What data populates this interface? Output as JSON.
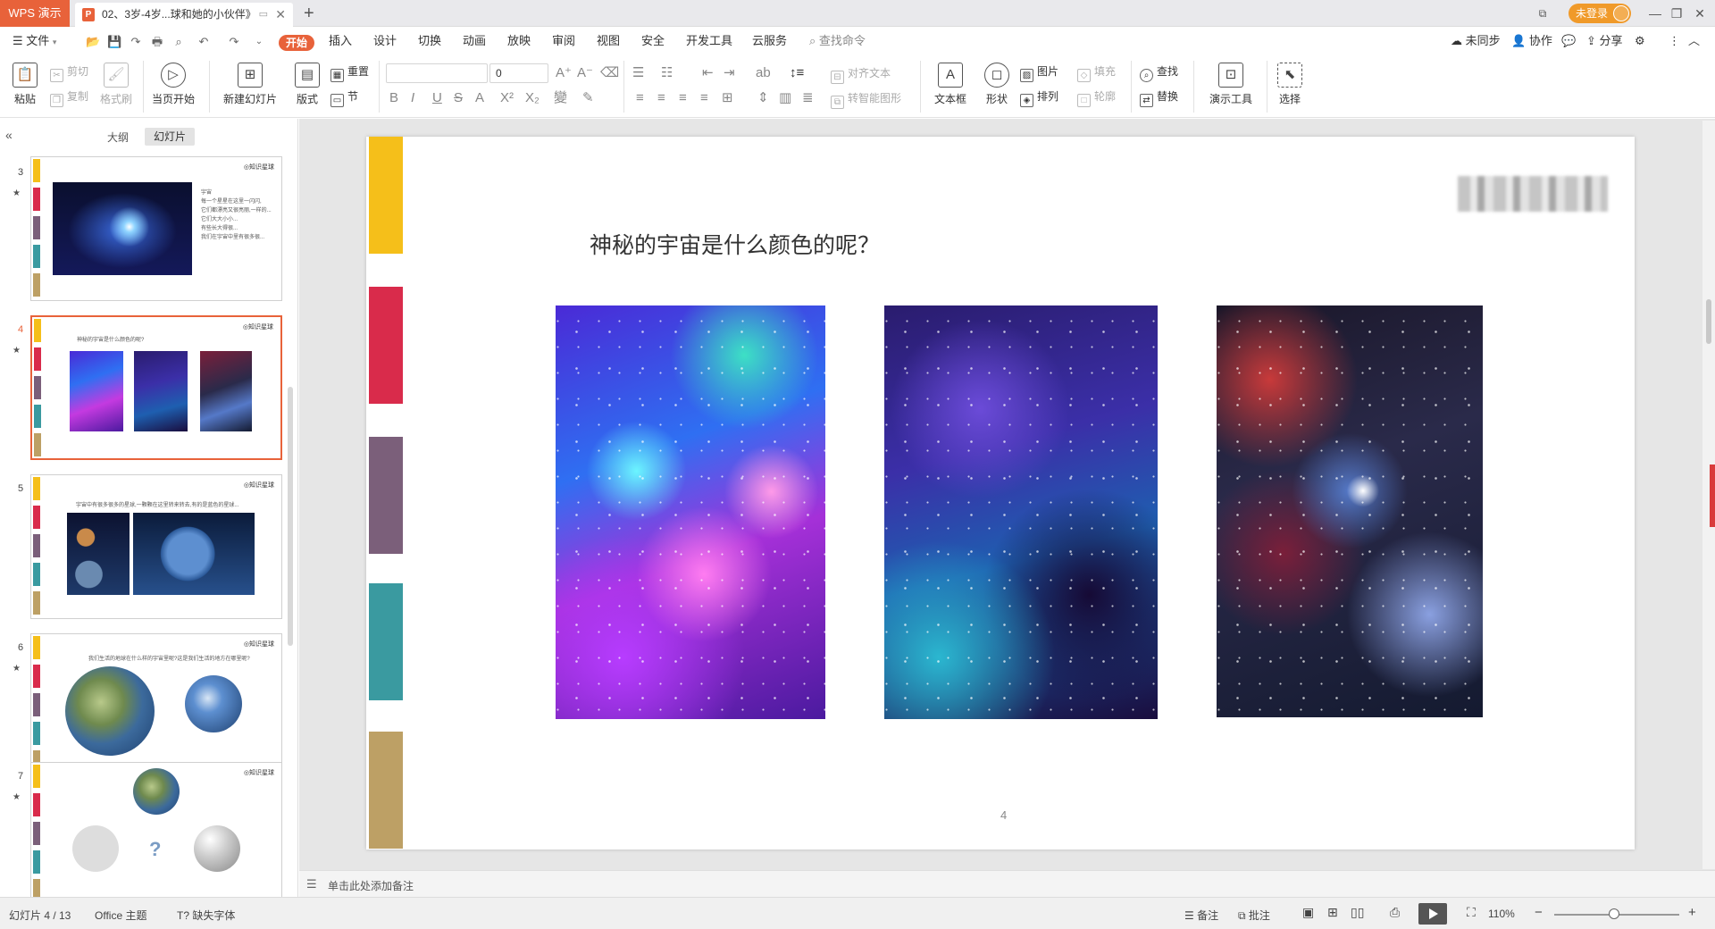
{
  "titlebar": {
    "app_tab": "WPS 演示",
    "doc_tab": "02、3岁-4岁...球和她的小伙伴》",
    "doc_icon": "P",
    "login_label": "未登录"
  },
  "menu": {
    "file": "文件",
    "start": "开始",
    "items": [
      "插入",
      "设计",
      "切换",
      "动画",
      "放映",
      "审阅",
      "视图",
      "安全",
      "开发工具",
      "云服务"
    ],
    "search_placeholder": "查找命令",
    "right": {
      "sync": "未同步",
      "collab": "协作",
      "share": "分享"
    }
  },
  "ribbon": {
    "paste": "粘贴",
    "cut": "剪切",
    "copy": "复制",
    "format_painter": "格式刷",
    "from_current": "当页开始",
    "new_slide": "新建幻灯片",
    "layout": "版式",
    "reset": "重置",
    "section": "节",
    "font_size_value": "0",
    "align_text": "对齐文本",
    "smartart": "转智能图形",
    "textbox": "文本框",
    "shape": "形状",
    "picture": "图片",
    "arrange": "排列",
    "fill": "填充",
    "outline": "轮廓",
    "find": "查找",
    "replace": "替换",
    "presenter_tools": "演示工具",
    "select": "选择"
  },
  "left_panel": {
    "tab_outline": "大纲",
    "tab_slides": "幻灯片",
    "thumbnails": [
      {
        "num": "3",
        "logo": "◎知识星球",
        "lines": [
          "宇宙",
          "每一个星星在这里一闪闪,",
          "它们都漂亮又很亮丽,一样的...",
          "它们大大小小...",
          "有些长大得很...",
          "我们在宇宙中里有很多很..."
        ]
      },
      {
        "num": "4",
        "logo": "◎知识星球",
        "lines": [
          "神秘的宇宙是什么颜色的呢?"
        ]
      },
      {
        "num": "5",
        "logo": "◎知识星球",
        "lines": [
          "宇宙中有很多很多的星球,一颗颗在这里转来转去,有的是蓝色的星球..."
        ]
      },
      {
        "num": "6",
        "logo": "◎知识星球",
        "lines": [
          "我们生活的地球在什么样的宇宙里呢?这是我们生活的地方在哪里呢?"
        ]
      },
      {
        "num": "7",
        "logo": "◎知识星球",
        "lines": [
          "?"
        ]
      }
    ]
  },
  "slide": {
    "title": "神秘的宇宙是什么颜色的呢？",
    "page_number": "4",
    "stripe_colors": [
      "#f5bf1a",
      "#d92b4b",
      "#7b5f7a",
      "#3a9aa0",
      "#bda065"
    ]
  },
  "notes": {
    "placeholder": "单击此处添加备注"
  },
  "status": {
    "slide_counter": "幻灯片 4 / 13",
    "theme": "Office 主题",
    "missing_font": "缺失字体",
    "notes": "备注",
    "comments": "批注",
    "zoom": "110%",
    "zoom_fraction": 0.48
  },
  "colors": {
    "accent": "#e8623a",
    "login": "#f09a2a"
  }
}
